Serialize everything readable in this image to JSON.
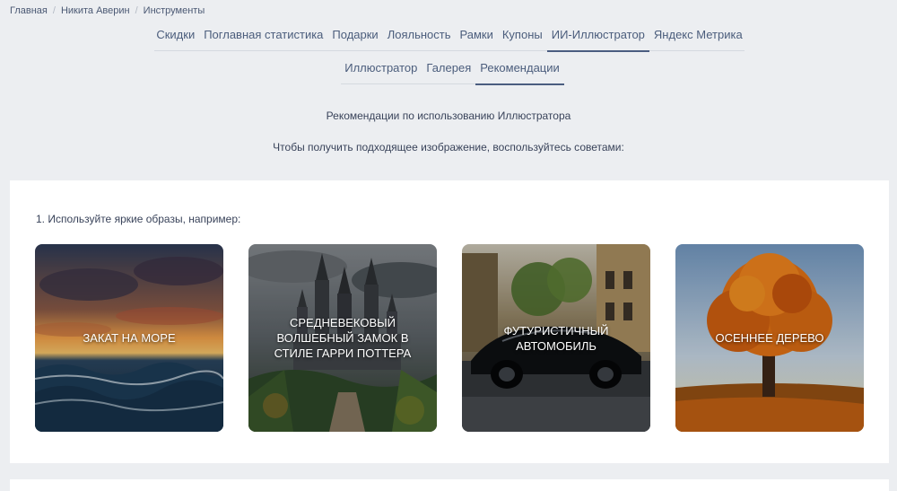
{
  "breadcrumb": {
    "items": [
      "Главная",
      "Никита Аверин",
      "Инструменты"
    ],
    "separator": "/"
  },
  "main_tabs": [
    "Скидки",
    "Поглавная статистика",
    "Подарки",
    "Лояльность",
    "Рамки",
    "Купоны",
    "ИИ-Иллюстратор",
    "Яндекс Метрика"
  ],
  "main_tabs_active": "ИИ-Иллюстратор",
  "sub_tabs": [
    "Иллюстратор",
    "Галерея",
    "Рекомендации"
  ],
  "sub_tabs_active": "Рекомендации",
  "intro": {
    "title": "Рекомендации по использованию Иллюстратора",
    "subtitle": "Чтобы получить подходящее изображение, воспользуйтесь советами:"
  },
  "tip": {
    "text": "1. Используйте яркие образы, например:",
    "cards": [
      {
        "caption": "ЗАКАТ НА МОРЕ",
        "image": "sunset-sea-image"
      },
      {
        "caption": "СРЕДНЕВЕКОВЫЙ ВОЛШЕБНЫЙ ЗАМОК В СТИЛЕ ГАРРИ ПОТТЕРА",
        "image": "castle-image"
      },
      {
        "caption": "ФУТУРИСТИЧНЫЙ АВТОМОБИЛЬ",
        "image": "futuristic-car-image"
      },
      {
        "caption": "ОСЕННЕЕ ДЕРЕВО",
        "image": "autumn-tree-image"
      }
    ]
  },
  "colors": {
    "page_bg": "#eceef1",
    "accent": "#4a5d80",
    "text": "#39435a"
  }
}
